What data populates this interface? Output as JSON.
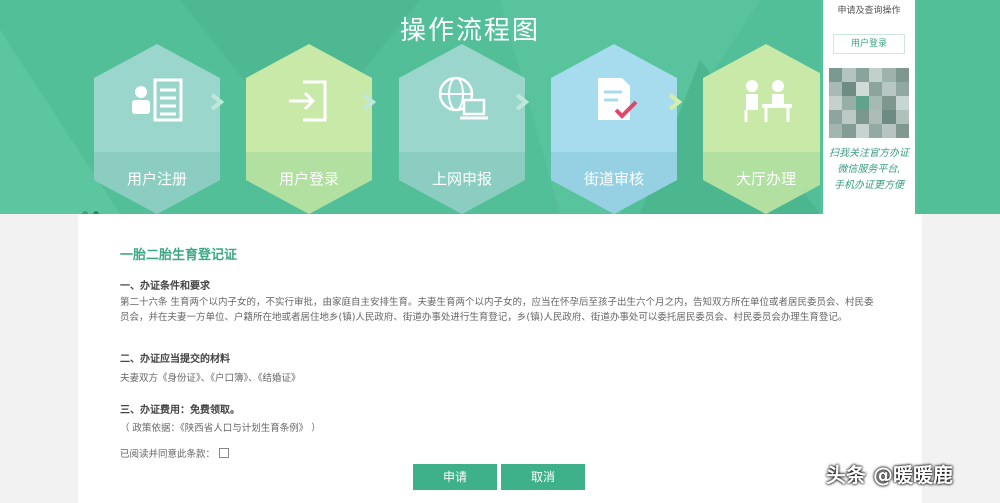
{
  "banner": {
    "title": "操作流程图",
    "steps": [
      {
        "label": "用户注册",
        "icon": "id-card-icon"
      },
      {
        "label": "用户登录",
        "icon": "login-icon"
      },
      {
        "label": "上网申报",
        "icon": "globe-laptop-icon"
      },
      {
        "label": "街道审核",
        "icon": "document-check-icon"
      },
      {
        "label": "大厅办理",
        "icon": "service-desk-icon"
      }
    ],
    "colors": {
      "bg": "#52bf98",
      "hex1": "#9ad6cc",
      "hex2": "#c8e9a8"
    }
  },
  "side": {
    "title": "申请及查询操作",
    "login_button": "用户登录",
    "note_line1": "扫我关注官方办证",
    "note_line2": "微信服务平台,",
    "note_line3": "手机办证更方便"
  },
  "content": {
    "title": "一胎二胎生育登记证",
    "section1": "一、办证条件和要求",
    "para1": "第二十六条 生育两个以内子女的，不实行审批，由家庭自主安排生育。夫妻生育两个以内子女的，应当在怀孕后至孩子出生六个月之内，告知双方所在单位或者居民委员会、村民委员会，并在夫妻一方单位、户籍所在地或者居住地乡(镇)人民政府、街道办事处进行生育登记，乡(镇)人民政府、街道办事处可以委托居民委员会、村民委员会办理生育登记。",
    "section2": "二、办证应当提交的材料",
    "para2": "夫妻双方《身份证》、《户口簿》、《结婚证》",
    "section3": "三、办证费用：免费领取。",
    "para3": "（ 政策依据：《陕西省人口与计划生育条例》 ）",
    "agree_label": "已阅读并同意此条款：",
    "apply_button": "申请",
    "cancel_button": "取消"
  },
  "watermark": "头条 @暖暖鹿"
}
